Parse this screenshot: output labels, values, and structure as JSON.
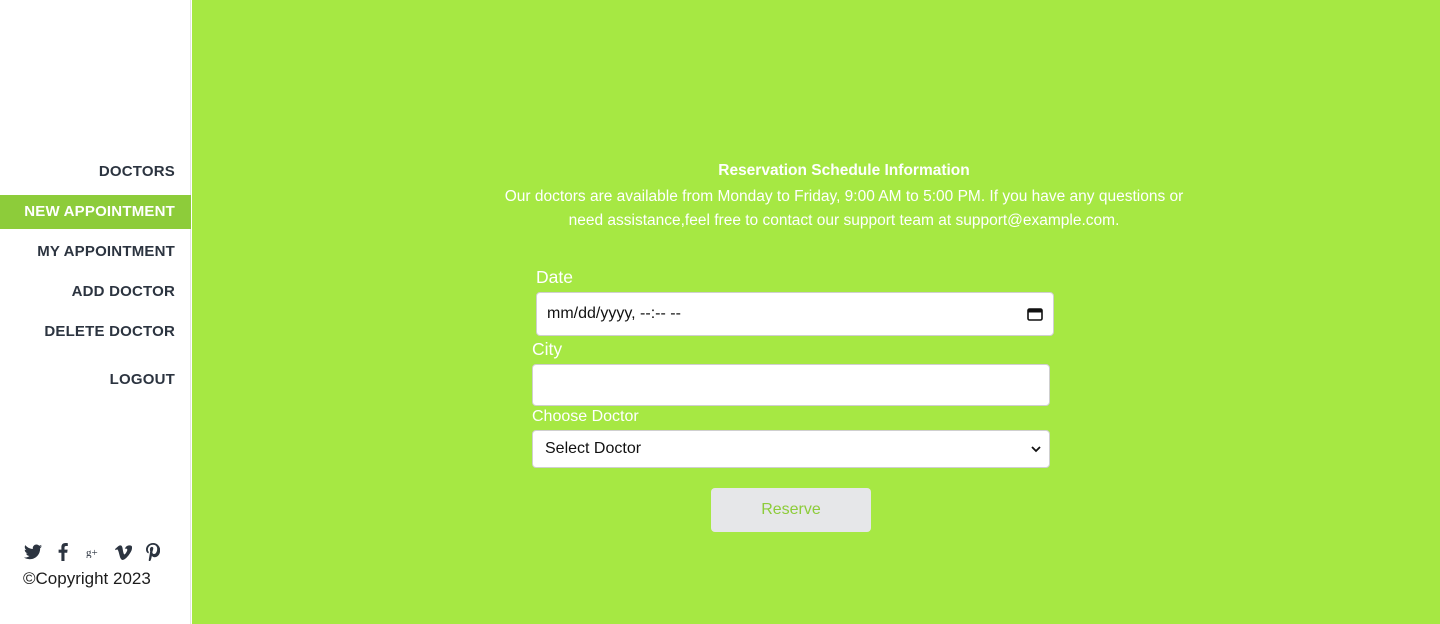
{
  "sidebar": {
    "items": [
      {
        "label": "DOCTORS",
        "active": false
      },
      {
        "label": "NEW APPOINTMENT",
        "active": true
      },
      {
        "label": "MY APPOINTMENT",
        "active": false
      },
      {
        "label": "ADD DOCTOR",
        "active": false
      },
      {
        "label": "DELETE DOCTOR",
        "active": false
      },
      {
        "label": "LOGOUT",
        "active": false
      }
    ],
    "social_icons": [
      "twitter-icon",
      "facebook-icon",
      "google-plus-icon",
      "vimeo-icon",
      "pinterest-icon"
    ],
    "copyright": "©Copyright 2023"
  },
  "main": {
    "info_title": "Reservation Schedule Information",
    "info_text": "Our doctors are available from Monday to Friday, 9:00 AM to 5:00 PM. If you have any questions or need assistance,feel free to contact our support team at support@example.com.",
    "form": {
      "date_label": "Date",
      "date_value": "mm/dd/yyyy, --:-- --",
      "city_label": "City",
      "city_value": "",
      "doctor_label": "Choose Doctor",
      "doctor_selected": "Select Doctor",
      "reserve_label": "Reserve"
    }
  },
  "colors": {
    "main_bg": "#a6e843",
    "active_nav_bg": "#8dcc3a",
    "nav_text": "#2c3440",
    "button_bg": "#e6e7e9"
  }
}
